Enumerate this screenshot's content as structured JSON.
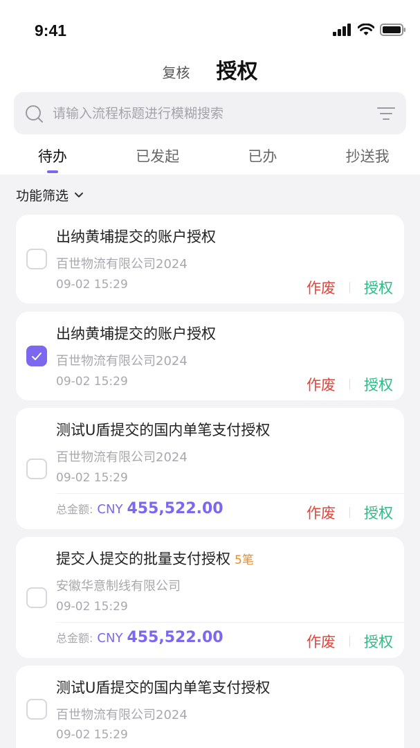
{
  "status_bar": {
    "time": "9:41"
  },
  "header": {
    "tabs": [
      {
        "label": "复核",
        "active": false
      },
      {
        "label": "授权",
        "active": true
      }
    ]
  },
  "search": {
    "placeholder": "请输入流程标题进行模糊搜索",
    "value": ""
  },
  "list_tabs": [
    {
      "label": "待办",
      "active": true
    },
    {
      "label": "已发起",
      "active": false
    },
    {
      "label": "已办",
      "active": false
    },
    {
      "label": "抄送我",
      "active": false
    }
  ],
  "filter": {
    "label": "功能筛选"
  },
  "cards": [
    {
      "title": "出纳黄埔提交的账户授权",
      "company": "百世物流有限公司2024",
      "time": "09-02 15:29",
      "checked": false
    },
    {
      "title": "出纳黄埔提交的账户授权",
      "company": "百世物流有限公司2024",
      "time": "09-02 15:29",
      "checked": true
    },
    {
      "title": "测试U盾提交的国内单笔支付授权",
      "company": "百世物流有限公司2024",
      "time": "09-02 15:29",
      "checked": false,
      "amount": {
        "label": "总金额:",
        "currency": "CNY",
        "value": "455,522.00"
      }
    },
    {
      "title": "提交人提交的批量支付授权",
      "badge": "5笔",
      "company": "安徽华意制线有限公司",
      "time": "09-02 15:29",
      "checked": false,
      "amount": {
        "label": "总金额:",
        "currency": "CNY",
        "value": "455,522.00"
      }
    },
    {
      "title": "测试U盾提交的国内单笔支付授权",
      "company": "百世物流有限公司2024",
      "time": "09-02 15:29",
      "checked": false
    }
  ],
  "actions": {
    "void_label": "作废",
    "authorize_label": "授权"
  },
  "colors": {
    "accent": "#7b68ee",
    "void": "#e2453c",
    "authorize": "#2fba86",
    "badge": "#f08a24"
  }
}
